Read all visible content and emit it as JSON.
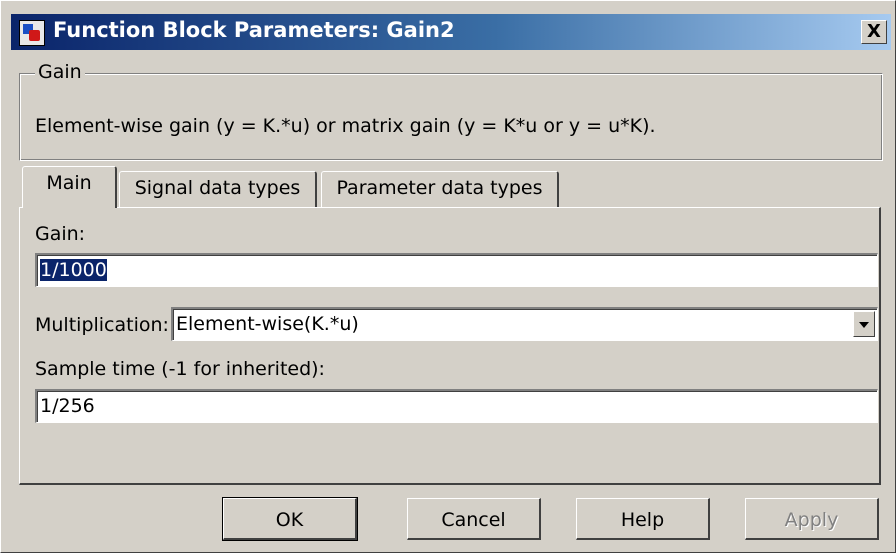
{
  "window": {
    "title": "Function Block Parameters: Gain2",
    "close_label": "X"
  },
  "group": {
    "legend": "Gain",
    "description": "Element-wise gain (y = K.*u) or matrix gain (y = K*u or y = u*K)."
  },
  "tabs": [
    {
      "label": "Main",
      "active": true
    },
    {
      "label": "Signal data types",
      "active": false
    },
    {
      "label": "Parameter data types",
      "active": false
    }
  ],
  "main": {
    "gain_label": "Gain:",
    "gain_value": "1/1000",
    "multiplication_label": "Multiplication:",
    "multiplication_value": "Element-wise(K.*u)",
    "sample_time_label": "Sample time (-1 for inherited):",
    "sample_time_value": "1/256"
  },
  "buttons": {
    "ok": "OK",
    "cancel": "Cancel",
    "help": "Help",
    "apply": "Apply"
  },
  "colors": {
    "titlebar_start": "#0a246a",
    "titlebar_end": "#a6caf0",
    "face": "#d4d0c8",
    "selection": "#0a246a"
  },
  "icons": {
    "app": "simulink-block-icon",
    "close": "close-icon",
    "dropdown": "chevron-down-icon"
  }
}
